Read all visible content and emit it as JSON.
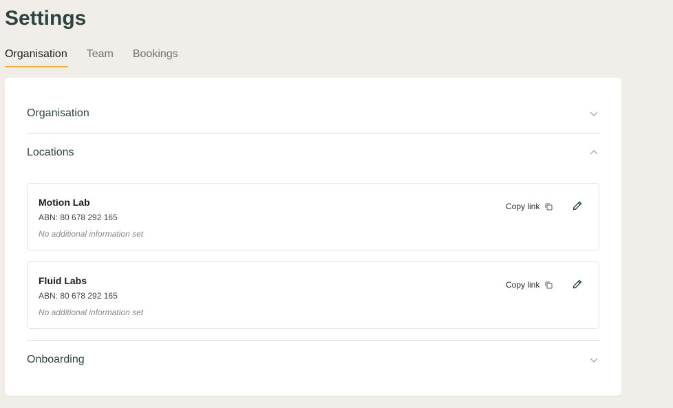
{
  "page": {
    "title": "Settings"
  },
  "tabs": [
    {
      "label": "Organisation",
      "active": true
    },
    {
      "label": "Team",
      "active": false
    },
    {
      "label": "Bookings",
      "active": false
    }
  ],
  "sections": {
    "organisation": {
      "label": "Organisation",
      "expanded": false
    },
    "locations": {
      "label": "Locations",
      "expanded": true
    },
    "onboarding": {
      "label": "Onboarding",
      "expanded": false
    }
  },
  "locations": [
    {
      "name": "Motion Lab",
      "abn": "ABN: 80 678 292 165",
      "info": "No additional information set",
      "copy_label": "Copy link"
    },
    {
      "name": "Fluid Labs",
      "abn": "ABN: 80 678 292 165",
      "info": "No additional information set",
      "copy_label": "Copy link"
    }
  ],
  "icons": {
    "collapse": "chevron-down-icon",
    "expand": "chevron-up-icon",
    "copy": "copy-icon",
    "edit": "pencil-icon"
  },
  "colors": {
    "background": "#f1eee9",
    "card": "#ffffff",
    "heading": "#2d4340",
    "tab_underline": "#f0b23c"
  }
}
